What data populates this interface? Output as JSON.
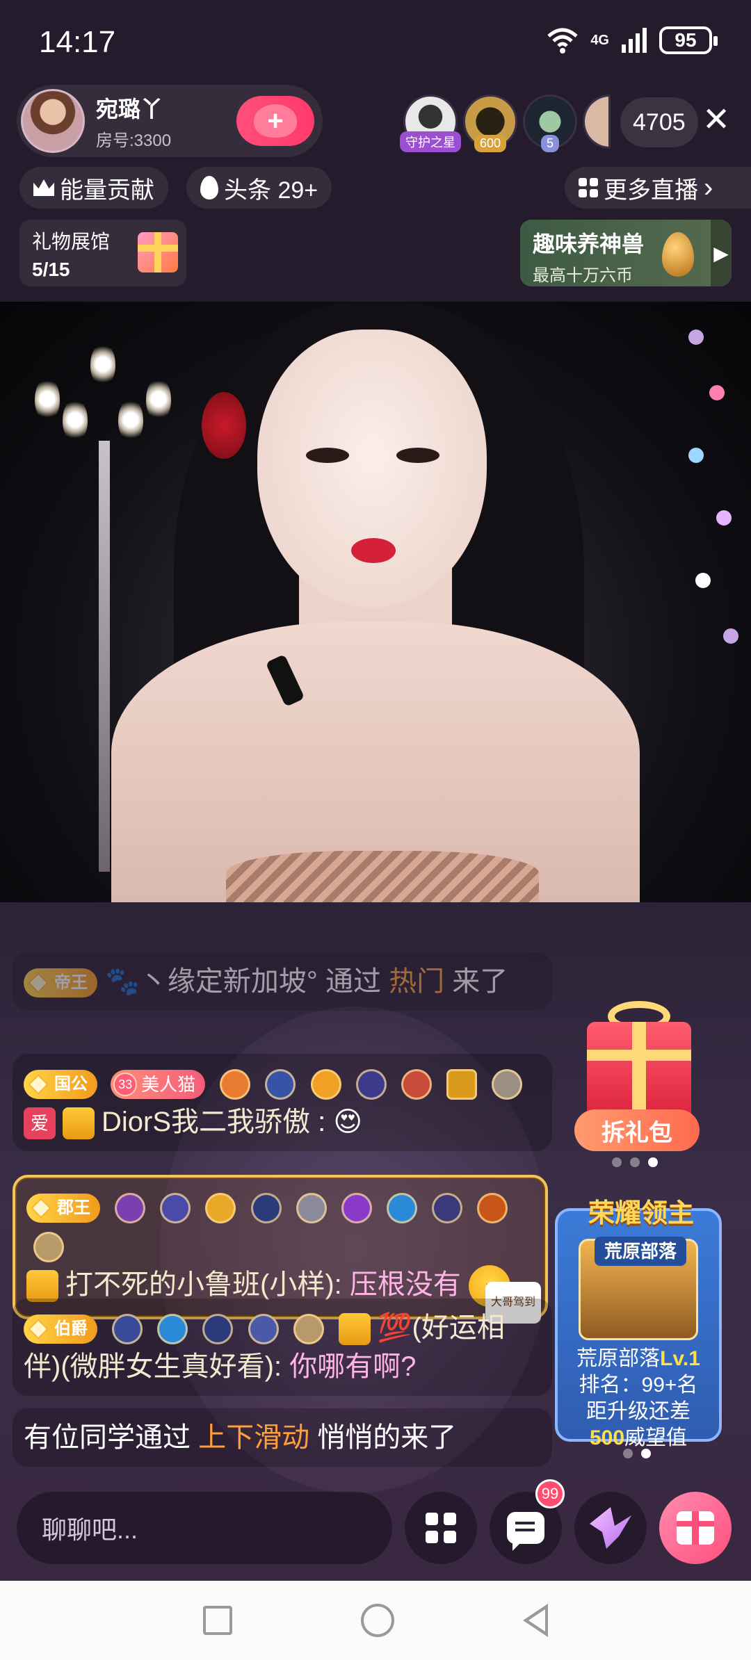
{
  "status_bar": {
    "time": "14:17",
    "network": "4G",
    "battery": "95"
  },
  "host": {
    "name": "宛璐丫",
    "room": "房号:3300",
    "follow_symbol": "+"
  },
  "viewers": {
    "badges": [
      "守护之星",
      "600",
      "5"
    ],
    "count": "4705",
    "close_symbol": "✕"
  },
  "top_row": {
    "energy_label": "能量贡献",
    "headline_label": "头条 29+",
    "more_live_label": "更多直播",
    "more_live_arrow": "›"
  },
  "gift_hall": {
    "title": "礼物展馆",
    "count": "5/15"
  },
  "promo": {
    "title": "趣味养神兽",
    "subtitle": "最高十万六币",
    "arrow": "▶"
  },
  "chat": {
    "msg1": {
      "tier": "帝王",
      "pre": "🐾丶缘定新加坡°  通过 ",
      "hot": "热门",
      "post": " 来了"
    },
    "msg2": {
      "tier": "国公",
      "pink_num": "33",
      "pink_label": "美人猫",
      "love": "爱",
      "user": "DiorS我二我骄傲",
      "sep": " : ",
      "emoji": "😍"
    },
    "msg3": {
      "tier": "郡王",
      "user": "打不死的小鲁班(小样): ",
      "text": "压根没有",
      "tag": "大哥驾到"
    },
    "msg4": {
      "tier": "伯爵",
      "user": "💯(好运相伴)(微胖女生真好看): ",
      "text": "你哪有啊?"
    },
    "msg5": {
      "pre": "有位同学通过 ",
      "hot": "上下滑动",
      "post": " 悄悄的来了"
    }
  },
  "gift_pack": {
    "button": "拆礼包"
  },
  "honor": {
    "title": "荣耀领主",
    "card_label": "荒原部落",
    "line1_prefix": "荒原部落",
    "line1_level": "Lv.1",
    "line2": "排名：99+名",
    "line3": "距升级还差",
    "line4_value": "500",
    "line4_suffix": "威望值"
  },
  "input": {
    "placeholder": "聊聊吧...",
    "unread": "99"
  }
}
